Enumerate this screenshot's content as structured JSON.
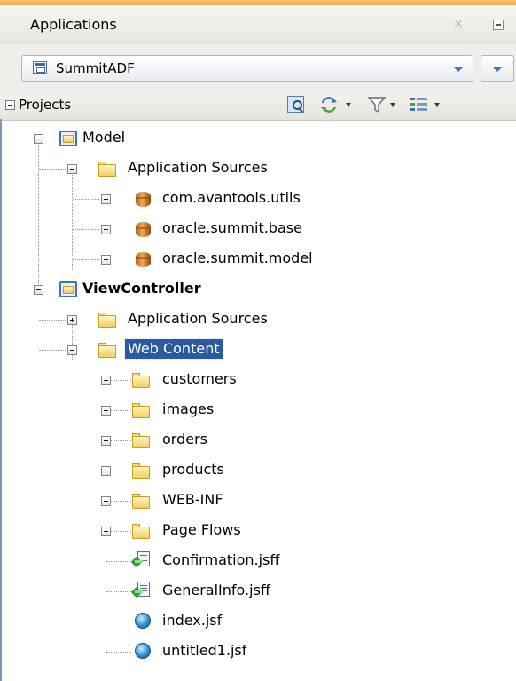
{
  "panel": {
    "title": "Applications",
    "close_glyph": "×",
    "accent_color": "#f0a848"
  },
  "application_selector": {
    "selected": "SummitADF",
    "icon": "application-icon"
  },
  "projects_toolbar": {
    "label": "Projects",
    "icons": [
      "find-icon",
      "sync-icon",
      "filter-icon",
      "layout-options-icon"
    ]
  },
  "tree": [
    {
      "label": "Model",
      "type": "project",
      "expanded": true
    },
    {
      "label": "Application Sources",
      "type": "folder",
      "expanded": true
    },
    {
      "label": "com.avantools.utils",
      "type": "package",
      "expanded": false
    },
    {
      "label": "oracle.summit.base",
      "type": "package",
      "expanded": false
    },
    {
      "label": "oracle.summit.model",
      "type": "package",
      "expanded": false
    },
    {
      "label": "ViewController",
      "type": "project",
      "expanded": true,
      "bold": true
    },
    {
      "label": "Application Sources",
      "type": "folder",
      "expanded": false
    },
    {
      "label": "Web Content",
      "type": "folder",
      "expanded": true,
      "selected": true
    },
    {
      "label": "customers",
      "type": "folder",
      "expanded": false
    },
    {
      "label": "images",
      "type": "folder",
      "expanded": false
    },
    {
      "label": "orders",
      "type": "folder",
      "expanded": false
    },
    {
      "label": "products",
      "type": "folder",
      "expanded": false
    },
    {
      "label": "WEB-INF",
      "type": "folder",
      "expanded": false
    },
    {
      "label": "Page Flows",
      "type": "folder",
      "expanded": false
    },
    {
      "label": "Confirmation.jsff",
      "type": "jsff"
    },
    {
      "label": "GeneralInfo.jsff",
      "type": "jsff"
    },
    {
      "label": "index.jsf",
      "type": "jsf"
    },
    {
      "label": "untitled1.jsf",
      "type": "jsf"
    }
  ],
  "selection_color": "#2a5aa0"
}
